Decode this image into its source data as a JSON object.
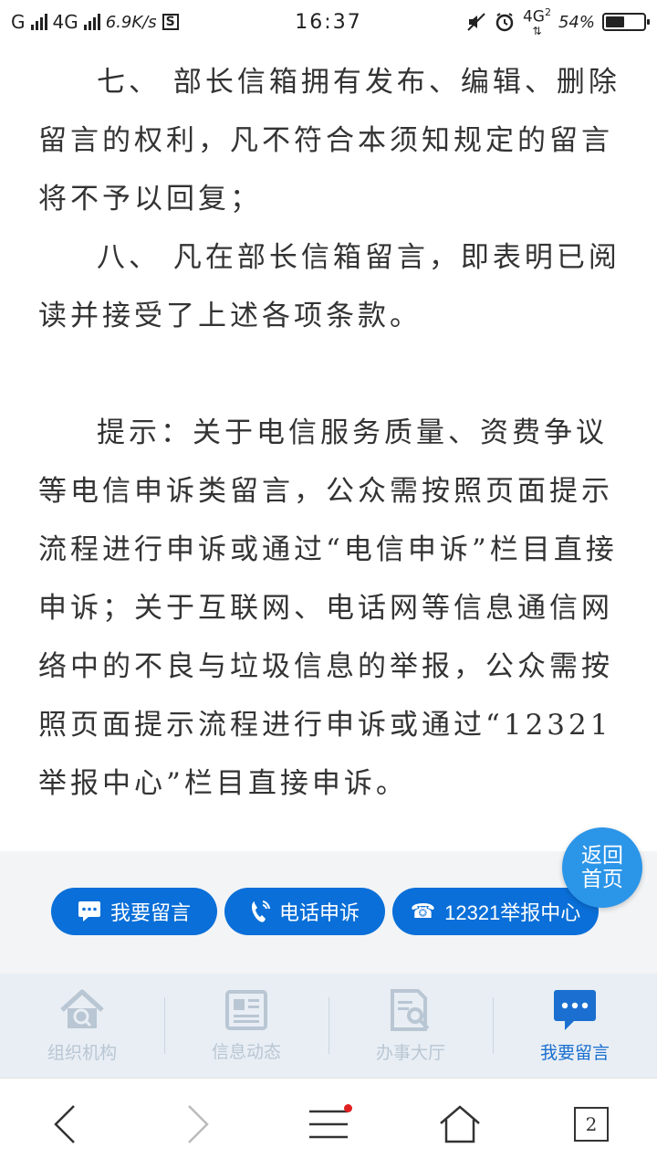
{
  "status": {
    "carrier": "G",
    "network": "4G",
    "speed": "6.9K/s",
    "s_badge": "S",
    "time": "16:37",
    "net_right": "4G",
    "sim_index": "2",
    "battery_pct": "54%",
    "battery_level": 0.54
  },
  "article": {
    "paragraphs": [
      "七、 部长信箱拥有发布、编辑、删除留言的权利，凡不符合本须知规定的留言将不予以回复；",
      "八、 凡在部长信箱留言，即表明已阅读并接受了上述各项条款。",
      "提示：关于电信服务质量、资费争议等电信申诉类留言，公众需按照页面提示流程进行申诉或通过“电信申诉”栏目直接申诉；关于互联网、电话网等信息通信网络中的不良与垃圾信息的举报，公众需按照页面提示流程进行申诉或通过“12321举报中心”栏目直接申诉。"
    ]
  },
  "back_home": {
    "label": "返回首页"
  },
  "actions": {
    "leave_message": "我要留言",
    "phone_complaint": "电话申诉",
    "report_center": "12321举报中心"
  },
  "tabs": [
    {
      "label": "组织机构",
      "icon": "house-icon"
    },
    {
      "label": "信息动态",
      "icon": "newspaper-icon"
    },
    {
      "label": "办事大厅",
      "icon": "document-search-icon"
    },
    {
      "label": "我要留言",
      "icon": "chat-bubble-icon"
    }
  ],
  "browser": {
    "tab_count": "2"
  },
  "colors": {
    "primary": "#0a6fd8",
    "active_tab": "#1a6fd0",
    "inactive_tab": "#b9c6d3",
    "back_home": "#2b95e8"
  }
}
